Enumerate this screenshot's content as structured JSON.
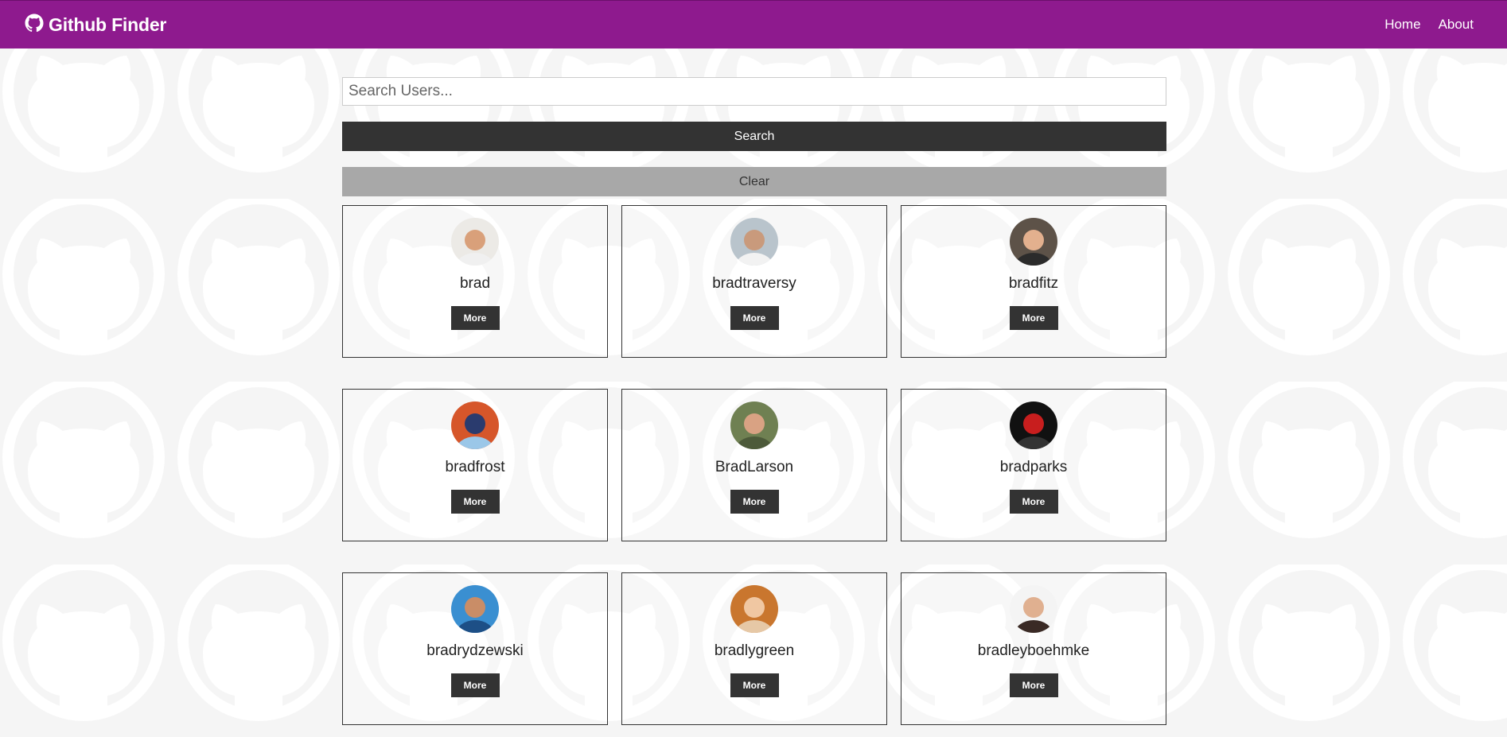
{
  "navbar": {
    "brand_icon": "github-icon",
    "title": "Github Finder",
    "links": [
      {
        "label": "Home"
      },
      {
        "label": "About"
      }
    ]
  },
  "search": {
    "placeholder": "Search Users...",
    "value": "",
    "search_button_label": "Search",
    "clear_button_label": "Clear"
  },
  "users": [
    {
      "login": "brad",
      "more_label": "More",
      "avatar": {
        "bg": "#eceae6",
        "skin": "#d9a07a",
        "shirt": "#f0f0f0"
      }
    },
    {
      "login": "bradtraversy",
      "more_label": "More",
      "avatar": {
        "bg": "#b9c4cc",
        "skin": "#c99a7c",
        "shirt": "#f2f2f2"
      }
    },
    {
      "login": "bradfitz",
      "more_label": "More",
      "avatar": {
        "bg": "#5d5248",
        "skin": "#e3b08e",
        "shirt": "#2b2b2b"
      }
    },
    {
      "login": "bradfrost",
      "more_label": "More",
      "avatar": {
        "bg": "#d6562a",
        "skin": "#2a3b6e",
        "shirt": "#9bc7e8"
      }
    },
    {
      "login": "BradLarson",
      "more_label": "More",
      "avatar": {
        "bg": "#6f8052",
        "skin": "#d9a283",
        "shirt": "#4d5a3a"
      }
    },
    {
      "login": "bradparks",
      "more_label": "More",
      "avatar": {
        "bg": "#111111",
        "skin": "#c81e1e",
        "shirt": "#333333"
      }
    },
    {
      "login": "bradrydzewski",
      "more_label": "More",
      "avatar": {
        "bg": "#3a8fd1",
        "skin": "#c98d67",
        "shirt": "#1d4f86"
      }
    },
    {
      "login": "bradlygreen",
      "more_label": "More",
      "avatar": {
        "bg": "#c9762e",
        "skin": "#f0c7a2",
        "shirt": "#e6c8a6"
      }
    },
    {
      "login": "bradleyboehmke",
      "more_label": "More",
      "avatar": {
        "bg": "#f4f4f4",
        "skin": "#e0b090",
        "shirt": "#3a2a25"
      }
    }
  ],
  "colors": {
    "navbar": "#8e1a8e",
    "dark_button": "#333333",
    "clear_button": "#a8a8a8",
    "background": "#f5f5f5"
  }
}
